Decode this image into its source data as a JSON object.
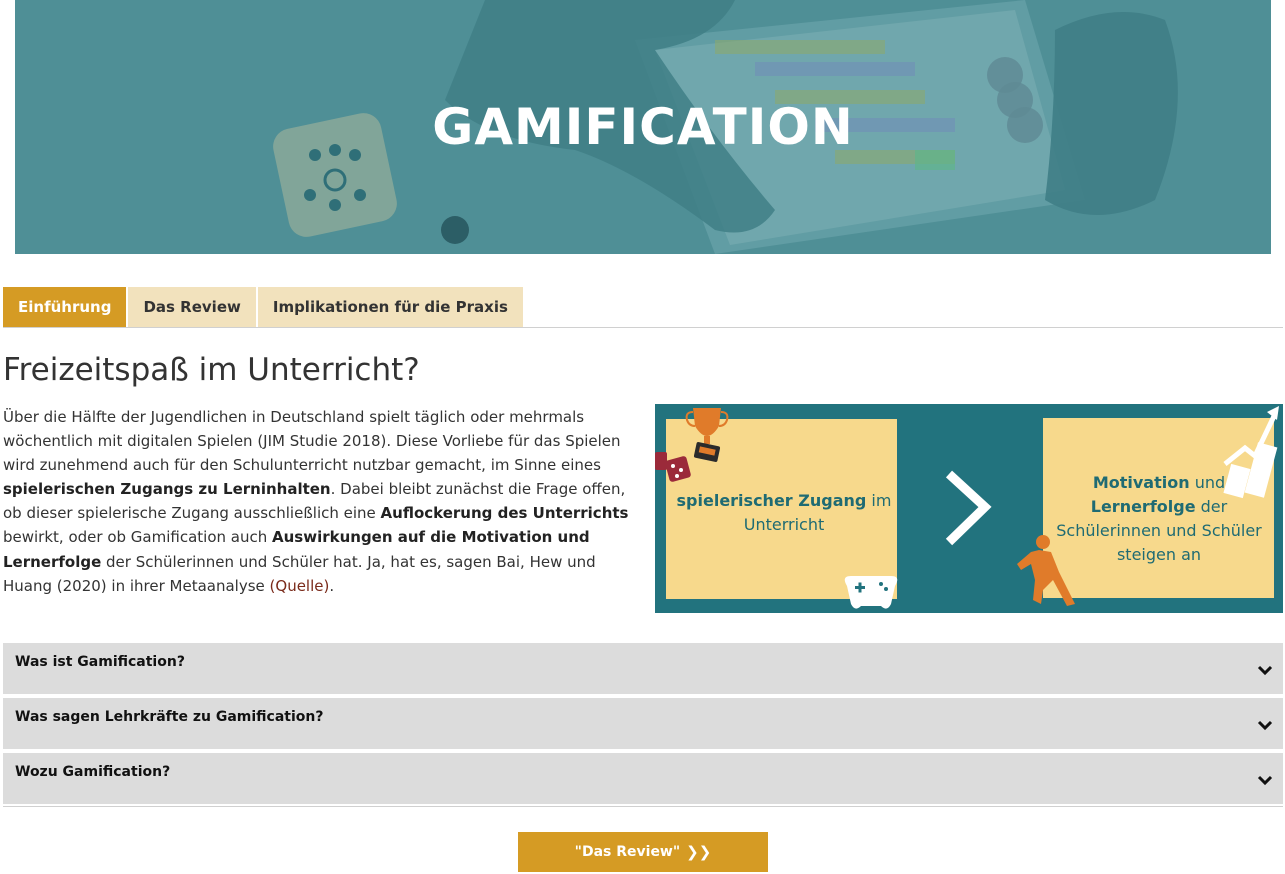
{
  "hero": {
    "title": "GAMIFICATION"
  },
  "tabs": [
    {
      "label": "Einführung",
      "active": true
    },
    {
      "label": "Das Review",
      "active": false
    },
    {
      "label": "Implikationen für die Praxis",
      "active": false
    }
  ],
  "section": {
    "heading": "Freizeitspaß im Unterricht?",
    "p1": "Über die Hälfte der Jugendlichen in Deutschland spielt täglich oder mehrmals wöchentlich mit digitalen Spielen (JIM Studie 2018). Diese Vorliebe für das Spielen wird zunehmend auch für den Schulunterricht nutzbar gemacht, im Sinne eines ",
    "b1": "spielerischen Zugangs zu Lerninhalten",
    "p2": ". Dabei bleibt zunächst die Frage offen, ob dieser spielerische Zugang ausschließlich eine ",
    "b2": "Auflockerung des Unterrichts",
    "p3": " bewirkt, oder ob Gamification auch ",
    "b3": "Auswirkungen auf die Motivation und Lernerfolge",
    "p4": " der Schülerinnen und Schüler hat. Ja, hat es, sagen Bai, Hew und Huang (2020) in ihrer Metaanalyse ",
    "link": "(Quelle)",
    "p5": "."
  },
  "infographic": {
    "left_bold": "spielerischer Zugang",
    "left_rest": " im Unterricht",
    "right_bold1": "Motivation",
    "right_mid": " und ",
    "right_bold2": "Lernerfolge",
    "right_rest": " der Schülerinnen und Schüler steigen an",
    "colors": {
      "background": "#22737e",
      "box": "#f7d98c",
      "accent": "#e07b2a"
    }
  },
  "accordion": [
    {
      "label": "Was ist Gamification?"
    },
    {
      "label": "Was sagen Lehrkräfte zu Gamification?"
    },
    {
      "label": "Wozu Gamification?"
    }
  ],
  "cta": {
    "label": "\"Das Review\"",
    "arrows": "❯❯"
  },
  "colors": {
    "accent": "#d59b24",
    "tab_inactive": "#f2e2bd",
    "hero": "#4f8f96"
  }
}
